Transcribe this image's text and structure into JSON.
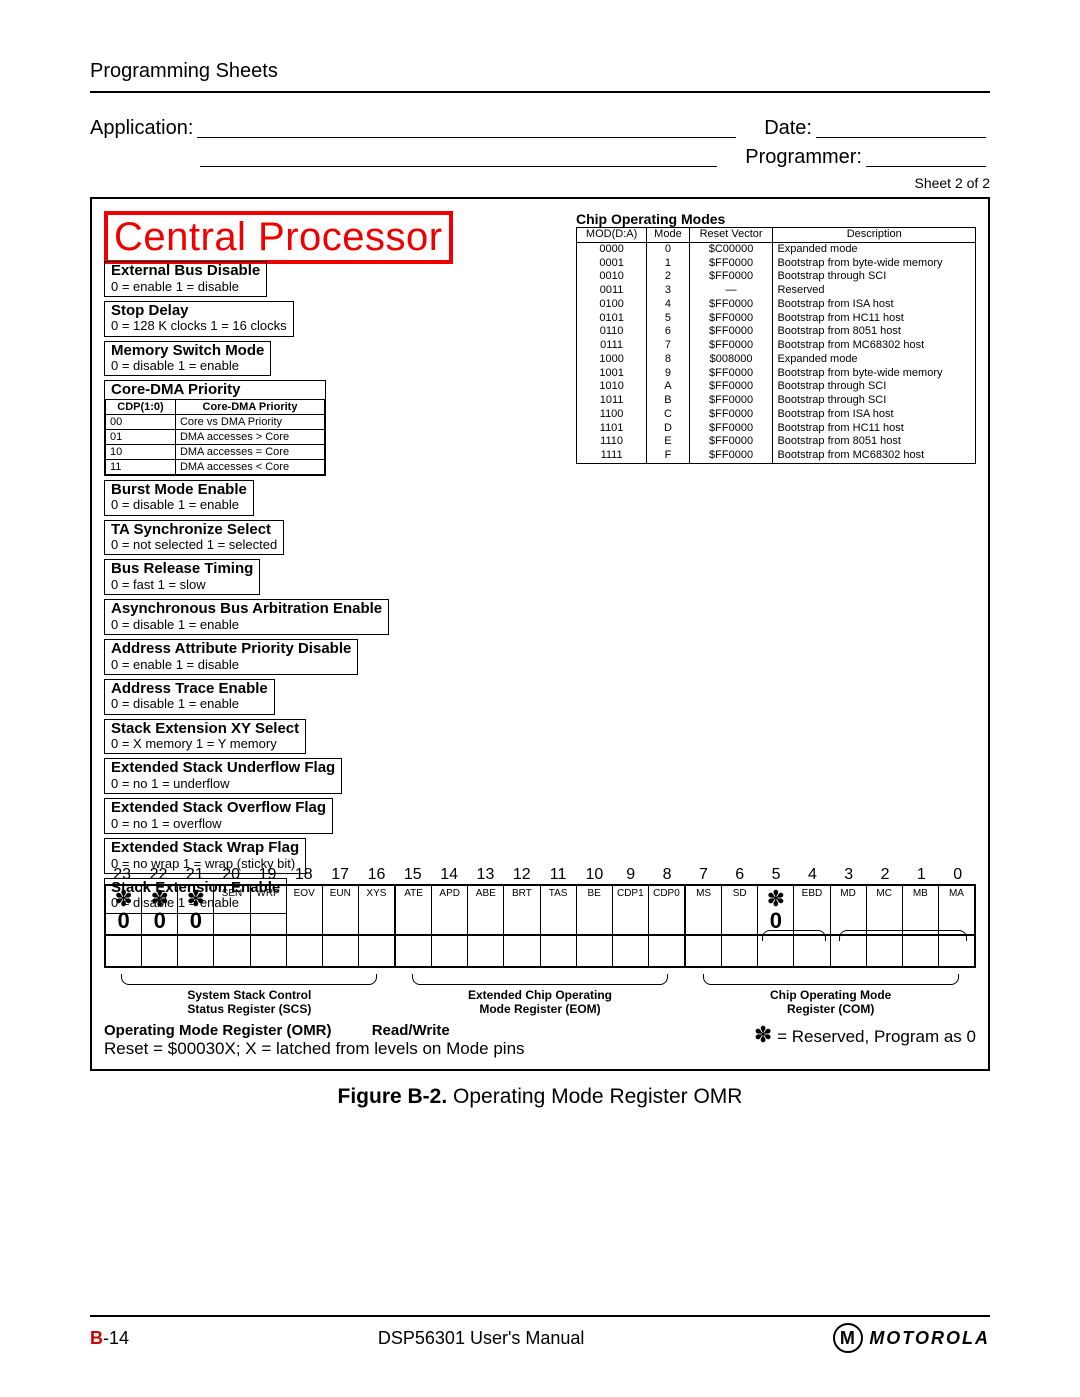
{
  "header": {
    "section": "Programming Sheets"
  },
  "form": {
    "application_label": "Application:",
    "date_label": "Date:",
    "programmer_label": "Programmer:",
    "sheet": "Sheet 2 of 2"
  },
  "title": "Central Processor",
  "callouts": [
    {
      "title": "External Bus Disable",
      "sub": "0 = enable 1 = disable"
    },
    {
      "title": "Stop Delay",
      "sub": "0 = 128 K clocks 1 = 16 clocks"
    },
    {
      "title": "Memory Switch Mode",
      "sub": "0 = disable 1 = enable"
    }
  ],
  "core_dma": {
    "title": "Core-DMA Priority",
    "headers": [
      "CDP(1:0)",
      "Core-DMA Priority"
    ],
    "rows": [
      [
        "00",
        "Core vs DMA Priority"
      ],
      [
        "01",
        "DMA accesses > Core"
      ],
      [
        "10",
        "DMA accesses = Core"
      ],
      [
        "11",
        "DMA accesses < Core"
      ]
    ]
  },
  "callouts2": [
    {
      "title": "Burst Mode Enable",
      "sub": "0 = disable 1 = enable"
    },
    {
      "title": "TA Synchronize Select",
      "sub": "0 = not selected 1 = selected"
    },
    {
      "title": "Bus Release Timing",
      "sub": "0 = fast 1 = slow"
    },
    {
      "title": "Asynchronous Bus Arbitration Enable",
      "sub": "0 = disable 1 = enable"
    },
    {
      "title": "Address Attribute Priority Disable",
      "sub": "0 = enable 1 = disable"
    },
    {
      "title": "Address Trace Enable",
      "sub": "0 = disable 1 = enable"
    },
    {
      "title": "Stack Extension XY Select",
      "sub": "0 = X memory 1 = Y memory"
    },
    {
      "title": "Extended Stack Underflow Flag",
      "sub": "0 = no 1 = underflow"
    },
    {
      "title": "Extended Stack Overflow Flag",
      "sub": "0 = no 1 = overflow"
    },
    {
      "title": "Extended Stack Wrap Flag",
      "sub": "0 = no wrap 1 = wrap (sticky bit)"
    },
    {
      "title": "Stack Extension Enable",
      "sub": "0 = disable 1 = enable"
    }
  ],
  "com": {
    "title": "Chip Operating Modes",
    "headers": [
      "MOD(D:A)",
      "Mode",
      "Reset Vector",
      "Description"
    ],
    "rows": [
      [
        "0000",
        "0",
        "$C00000",
        "Expanded mode"
      ],
      [
        "0001",
        "1",
        "$FF0000",
        "Bootstrap from byte-wide memory"
      ],
      [
        "0010",
        "2",
        "$FF0000",
        "Bootstrap through SCI"
      ],
      [
        "0011",
        "3",
        "—",
        "Reserved"
      ],
      [
        "0100",
        "4",
        "$FF0000",
        "Bootstrap from ISA host"
      ],
      [
        "0101",
        "5",
        "$FF0000",
        "Bootstrap from HC11 host"
      ],
      [
        "0110",
        "6",
        "$FF0000",
        "Bootstrap from 8051 host"
      ],
      [
        "0111",
        "7",
        "$FF0000",
        "Bootstrap from MC68302 host"
      ],
      [
        "1000",
        "8",
        "$008000",
        "Expanded mode"
      ],
      [
        "1001",
        "9",
        "$FF0000",
        "Bootstrap from byte-wide memory"
      ],
      [
        "1010",
        "A",
        "$FF0000",
        "Bootstrap through SCI"
      ],
      [
        "1011",
        "B",
        "$FF0000",
        "Bootstrap through SCI"
      ],
      [
        "1100",
        "C",
        "$FF0000",
        "Bootstrap from ISA host"
      ],
      [
        "1101",
        "D",
        "$FF0000",
        "Bootstrap from HC11 host"
      ],
      [
        "1110",
        "E",
        "$FF0000",
        "Bootstrap from 8051 host"
      ],
      [
        "1111",
        "F",
        "$FF0000",
        "Bootstrap from MC68302 host"
      ]
    ]
  },
  "bits": {
    "numbers": [
      "23",
      "22",
      "21",
      "20",
      "19",
      "18",
      "17",
      "16",
      "15",
      "14",
      "13",
      "12",
      "11",
      "10",
      "9",
      "8",
      "7",
      "6",
      "5",
      "4",
      "3",
      "2",
      "1",
      "0"
    ],
    "labels": [
      "*",
      "*",
      "*",
      "SEN",
      "WRP",
      "EOV",
      "EUN",
      "XYS",
      "ATE",
      "APD",
      "ABE",
      "BRT",
      "TAS",
      "BE",
      "CDP1",
      "CDP0",
      "MS",
      "SD",
      "*",
      "EBD",
      "MD",
      "MC",
      "MB",
      "MA"
    ],
    "zeros": [
      "0",
      "0",
      "0",
      "",
      "",
      "",
      "",
      "",
      "",
      "",
      "",
      "",
      "",
      "",
      "",
      "",
      "",
      "",
      "0",
      "",
      "",
      "",
      "",
      ""
    ],
    "groups": [
      {
        "span": 8,
        "name": "System Stack Control\nStatus Register (SCS)"
      },
      {
        "span": 8,
        "name": "Extended Chip Operating\nMode Register (EOM)"
      },
      {
        "span": 8,
        "name": "Chip Operating  Mode\nRegister (COM)"
      }
    ]
  },
  "reg_footer": {
    "name": "Operating Mode Register (OMR)",
    "rw": "Read/Write",
    "reset": "Reset = $00030X; X = latched from levels on Mode pins",
    "reserved": "= Reserved, Program as 0",
    "star": "✽"
  },
  "figure": {
    "num": "Figure B-2.",
    "title": " Operating Mode Register OMR"
  },
  "footer": {
    "page_prefix": "B",
    "page_num": "-14",
    "manual": "DSP56301 User's Manual",
    "brand": "MOTOROLA",
    "brand_glyph": "M"
  }
}
